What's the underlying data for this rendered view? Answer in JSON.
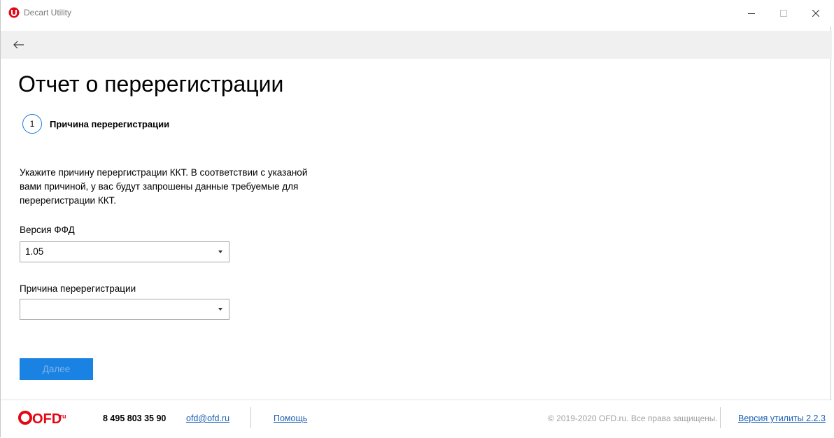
{
  "window": {
    "title": "Decart Utility"
  },
  "page": {
    "title": "Отчет о перерегистрации"
  },
  "step": {
    "number": "1",
    "label": "Причина перерегистрации"
  },
  "description": {
    "line1": "Укажите причину перергистрации ККТ. В соответствии с указаной",
    "line2": "вами причиной, у вас будут запрошены данные требуемые для",
    "line3": "перерегистрации ККТ."
  },
  "form": {
    "ffd_label": "Версия ФФД",
    "ffd_value": "1.05",
    "reason_label": "Причина перерегистрации",
    "reason_value": "",
    "next_label": "Далее"
  },
  "footer": {
    "logo_text": "OFD",
    "logo_suffix": ".ru",
    "phone": "8 495 803 35 90",
    "email": "ofd@ofd.ru",
    "help": "Помощь",
    "copyright": "© 2019-2020 OFD.ru. Все права защищены.",
    "version": "Версия утилиты 2.2.3"
  },
  "colors": {
    "accent": "#1a82e2",
    "brand_red": "#e30613",
    "link": "#1a5fb4"
  },
  "icons": {
    "app": "app-logo-icon",
    "back": "arrow-left-icon",
    "minimize": "minimize-icon",
    "maximize": "maximize-icon",
    "close": "close-icon",
    "dropdown": "chevron-down-icon"
  }
}
